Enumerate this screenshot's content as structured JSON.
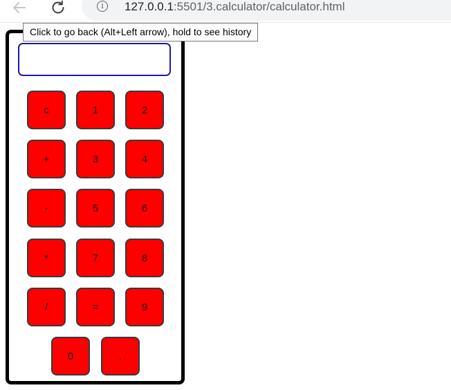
{
  "browser": {
    "url_host": "127.0.0.1",
    "url_rest": ":5501/3.calculator/calculator.html",
    "tooltip": "Click to go back (Alt+Left arrow), hold to see history",
    "icons": {
      "back": "back-arrow-icon",
      "reload": "reload-icon",
      "info": "info-icon"
    }
  },
  "calculator": {
    "display_value": "",
    "keys": {
      "clear": "c",
      "one": "1",
      "two": "2",
      "plus": "+",
      "three": "3",
      "four": "4",
      "minus": "-",
      "five": "5",
      "six": "6",
      "multiply": "*",
      "seven": "7",
      "eight": "8",
      "divide": "/",
      "equals": "=",
      "nine": "9",
      "zero": "0",
      "dot": "."
    },
    "colors": {
      "key_fill": "#ff0000",
      "display_border": "#1a1aa6",
      "frame_border": "#000000"
    }
  }
}
